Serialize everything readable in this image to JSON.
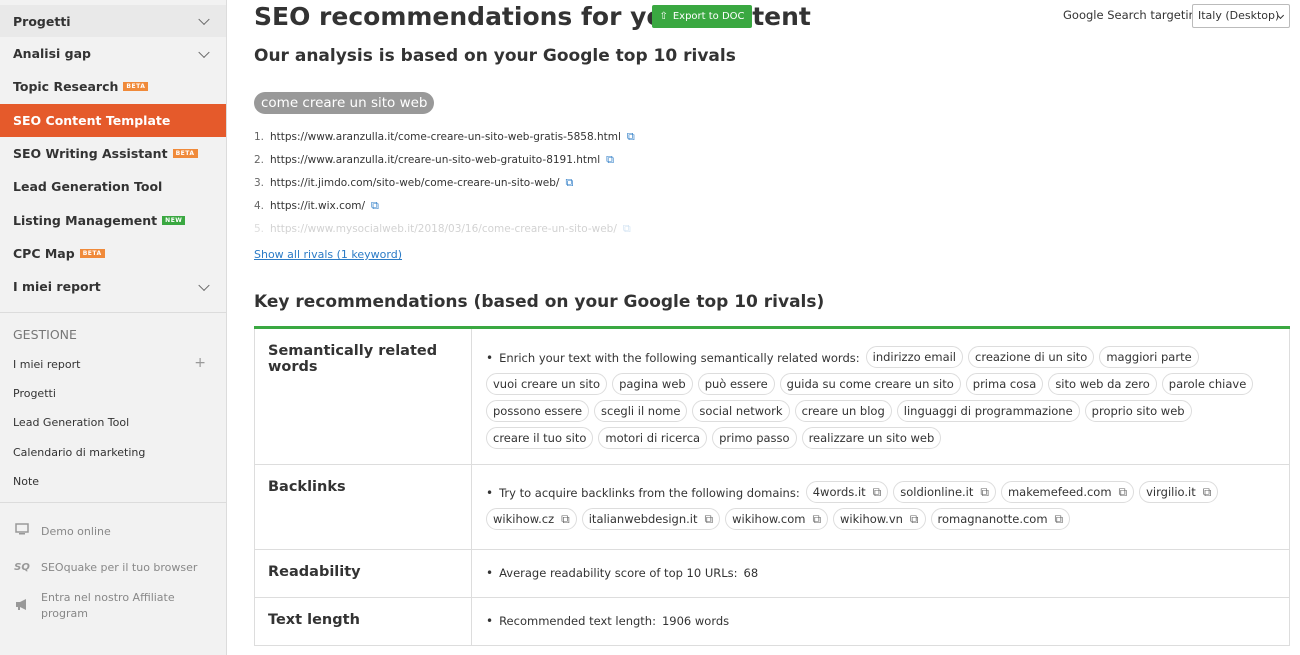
{
  "sidebar": {
    "nav": [
      {
        "label": "Progetti",
        "chevron": true
      },
      {
        "label": "Analisi gap",
        "chevron": true
      },
      {
        "label": "Topic Research",
        "badge": "BETA",
        "badge_type": "beta"
      },
      {
        "label": "SEO Content Template",
        "active": true
      },
      {
        "label": "SEO Writing Assistant",
        "badge": "BETA",
        "badge_type": "beta"
      },
      {
        "label": "Lead Generation Tool"
      },
      {
        "label": "Listing Management",
        "badge": "NEW",
        "badge_type": "new"
      },
      {
        "label": "CPC Map",
        "badge": "BETA",
        "badge_type": "beta"
      },
      {
        "label": "I miei report",
        "chevron": true
      }
    ],
    "section_title": "GESTIONE",
    "sub_items": [
      {
        "label": "I miei report",
        "plus": true
      },
      {
        "label": "Progetti"
      },
      {
        "label": "Lead Generation Tool"
      },
      {
        "label": "Calendario di marketing"
      },
      {
        "label": "Note"
      }
    ],
    "footer": [
      {
        "label": "Demo online",
        "icon": "monitor-icon"
      },
      {
        "label": "SEOquake per il tuo browser",
        "icon": "seoquake-icon"
      },
      {
        "label": "Entra nel nostro Affiliate program",
        "icon": "megaphone-icon"
      }
    ]
  },
  "header": {
    "title": "SEO recommendations for your content",
    "export_label": "Export to DOC",
    "targeting_label": "Google Search targeting:",
    "targeting_value": "Italy (Desktop)"
  },
  "analysis": {
    "subtitle": "Our analysis is based on your Google top 10 rivals",
    "keyword": "come creare un sito web",
    "rivals": [
      {
        "num": "1.",
        "url": "https://www.aranzulla.it/come-creare-un-sito-web-gratis-5858.html"
      },
      {
        "num": "2.",
        "url": "https://www.aranzulla.it/creare-un-sito-web-gratuito-8191.html"
      },
      {
        "num": "3.",
        "url": "https://it.jimdo.com/sito-web/come-creare-un-sito-web/"
      },
      {
        "num": "4.",
        "url": "https://it.wix.com/"
      },
      {
        "num": "5.",
        "url": "https://www.mysocialweb.it/2018/03/16/come-creare-un-sito-web/"
      }
    ],
    "show_all": "Show all rivals (1 keyword)"
  },
  "recommendations": {
    "title": "Key recommendations (based on your Google top 10 rivals)",
    "semantic": {
      "head": "Semantically related words",
      "intro": "Enrich your text with the following semantically related words:",
      "words": [
        "indirizzo email",
        "creazione di un sito",
        "maggiori parte",
        "vuoi creare un sito",
        "pagina web",
        "può essere",
        "guida su come creare un sito",
        "prima cosa",
        "sito web da zero",
        "parole chiave",
        "possono essere",
        "scegli il nome",
        "social network",
        "creare un blog",
        "linguaggi di programmazione",
        "proprio sito web",
        "creare il tuo sito",
        "motori di ricerca",
        "primo passo",
        "realizzare un sito web"
      ]
    },
    "backlinks": {
      "head": "Backlinks",
      "intro": "Try to acquire backlinks from the following domains:",
      "domains": [
        "4words.it",
        "soldionline.it",
        "makemefeed.com",
        "virgilio.it",
        "wikihow.cz",
        "italianwebdesign.it",
        "wikihow.com",
        "wikihow.vn",
        "romagnanotte.com"
      ]
    },
    "readability": {
      "head": "Readability",
      "label": "Average readability score of top 10 URLs:",
      "value": "68"
    },
    "text_length": {
      "head": "Text length",
      "label": "Recommended text length:",
      "value": "1906 words"
    }
  }
}
